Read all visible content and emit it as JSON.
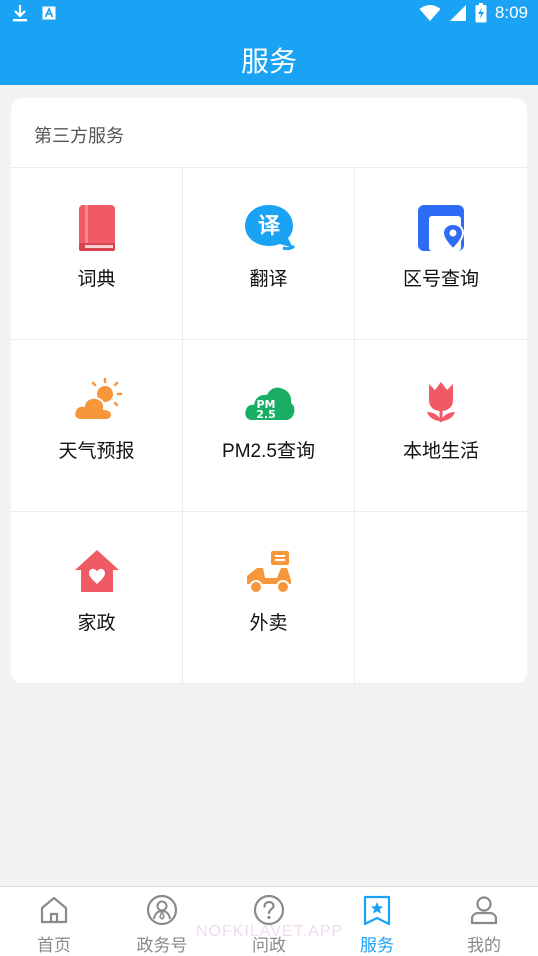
{
  "status_bar": {
    "time": "8:09",
    "icons": [
      "download-icon",
      "text-a-icon",
      "wifi-icon",
      "signal-icon",
      "battery-charging-icon"
    ]
  },
  "app_bar": {
    "title": "服务"
  },
  "section": {
    "title": "第三方服务",
    "items": [
      {
        "label": "词典",
        "icon": "book-icon",
        "color": "#ef5a64"
      },
      {
        "label": "翻译",
        "icon": "translate-bubble-icon",
        "color": "#1aa3f5"
      },
      {
        "label": "区号查询",
        "icon": "location-card-icon",
        "color": "#2f6cf5"
      },
      {
        "label": "天气预报",
        "icon": "cloud-sun-icon",
        "color": "#f7963b"
      },
      {
        "label": "PM2.5查询",
        "icon": "pm25-cloud-icon",
        "color": "#1aae64"
      },
      {
        "label": "本地生活",
        "icon": "tulip-icon",
        "color": "#ef5a64"
      },
      {
        "label": "家政",
        "icon": "house-heart-icon",
        "color": "#ef5a64"
      },
      {
        "label": "外卖",
        "icon": "delivery-scooter-icon",
        "color": "#f7963b"
      }
    ]
  },
  "bottom_nav": {
    "items": [
      {
        "label": "首页",
        "icon": "home-icon",
        "active": false
      },
      {
        "label": "政务号",
        "icon": "person-circle-icon",
        "active": false
      },
      {
        "label": "问政",
        "icon": "question-circle-icon",
        "active": false
      },
      {
        "label": "服务",
        "icon": "star-bookmark-icon",
        "active": true
      },
      {
        "label": "我的",
        "icon": "user-icon",
        "active": false
      }
    ],
    "watermark": "NOFKILAVET.APP"
  },
  "colors": {
    "primary": "#1aa3f5",
    "background": "#f2f2f2",
    "inactive": "#8a8a8a"
  }
}
